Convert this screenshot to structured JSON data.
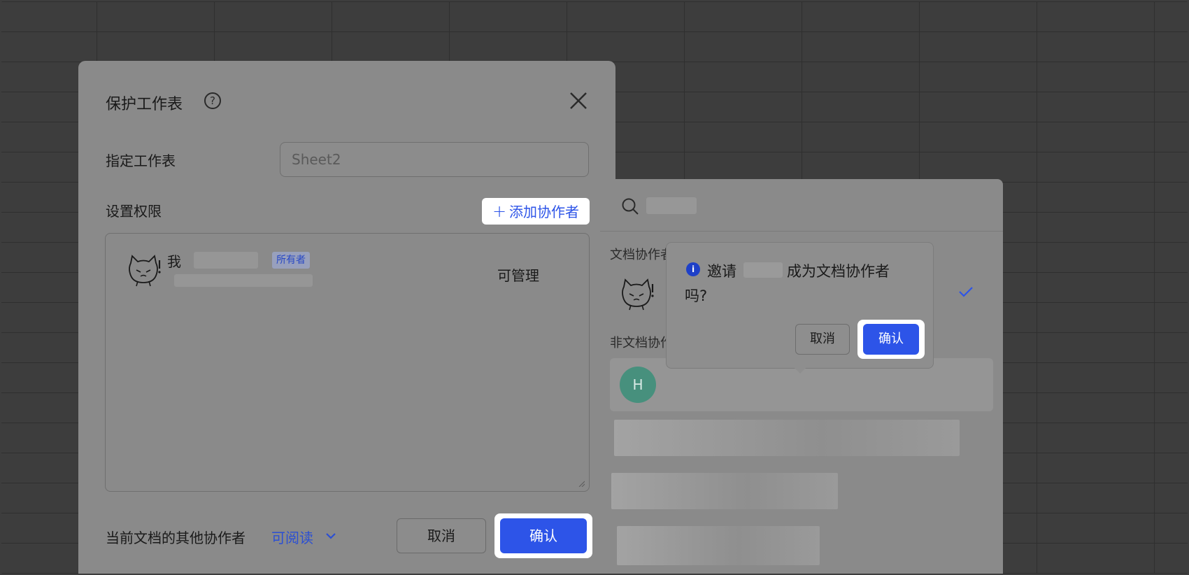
{
  "dialog": {
    "title": "保护工作表",
    "sheet_label": "指定工作表",
    "sheet_value": "Sheet2",
    "permission_label": "设置权限",
    "add_collaborator": "添加协作者",
    "permissions": [
      {
        "name_prefix": "我",
        "badge": "所有者",
        "permission": "可管理"
      }
    ],
    "other_collaborators_label": "当前文档的其他协作者",
    "other_collaborators_permission": "可阅读",
    "cancel_label": "取消",
    "confirm_label": "确认"
  },
  "panel": {
    "section_doc_collaborators": "文档协作者",
    "section_non_doc_collaborators": "非文档协作者",
    "non_collab_avatar_letter": "H"
  },
  "popover": {
    "text_invite": "邀请",
    "text_become": "成为文档协作者",
    "text_question": "吗?",
    "cancel_label": "取消",
    "confirm_label": "确认",
    "info_icon": "i"
  },
  "colors": {
    "accent": "#2d54e8",
    "overlay": "#8a8a8a",
    "background": "#3d3d3d"
  }
}
